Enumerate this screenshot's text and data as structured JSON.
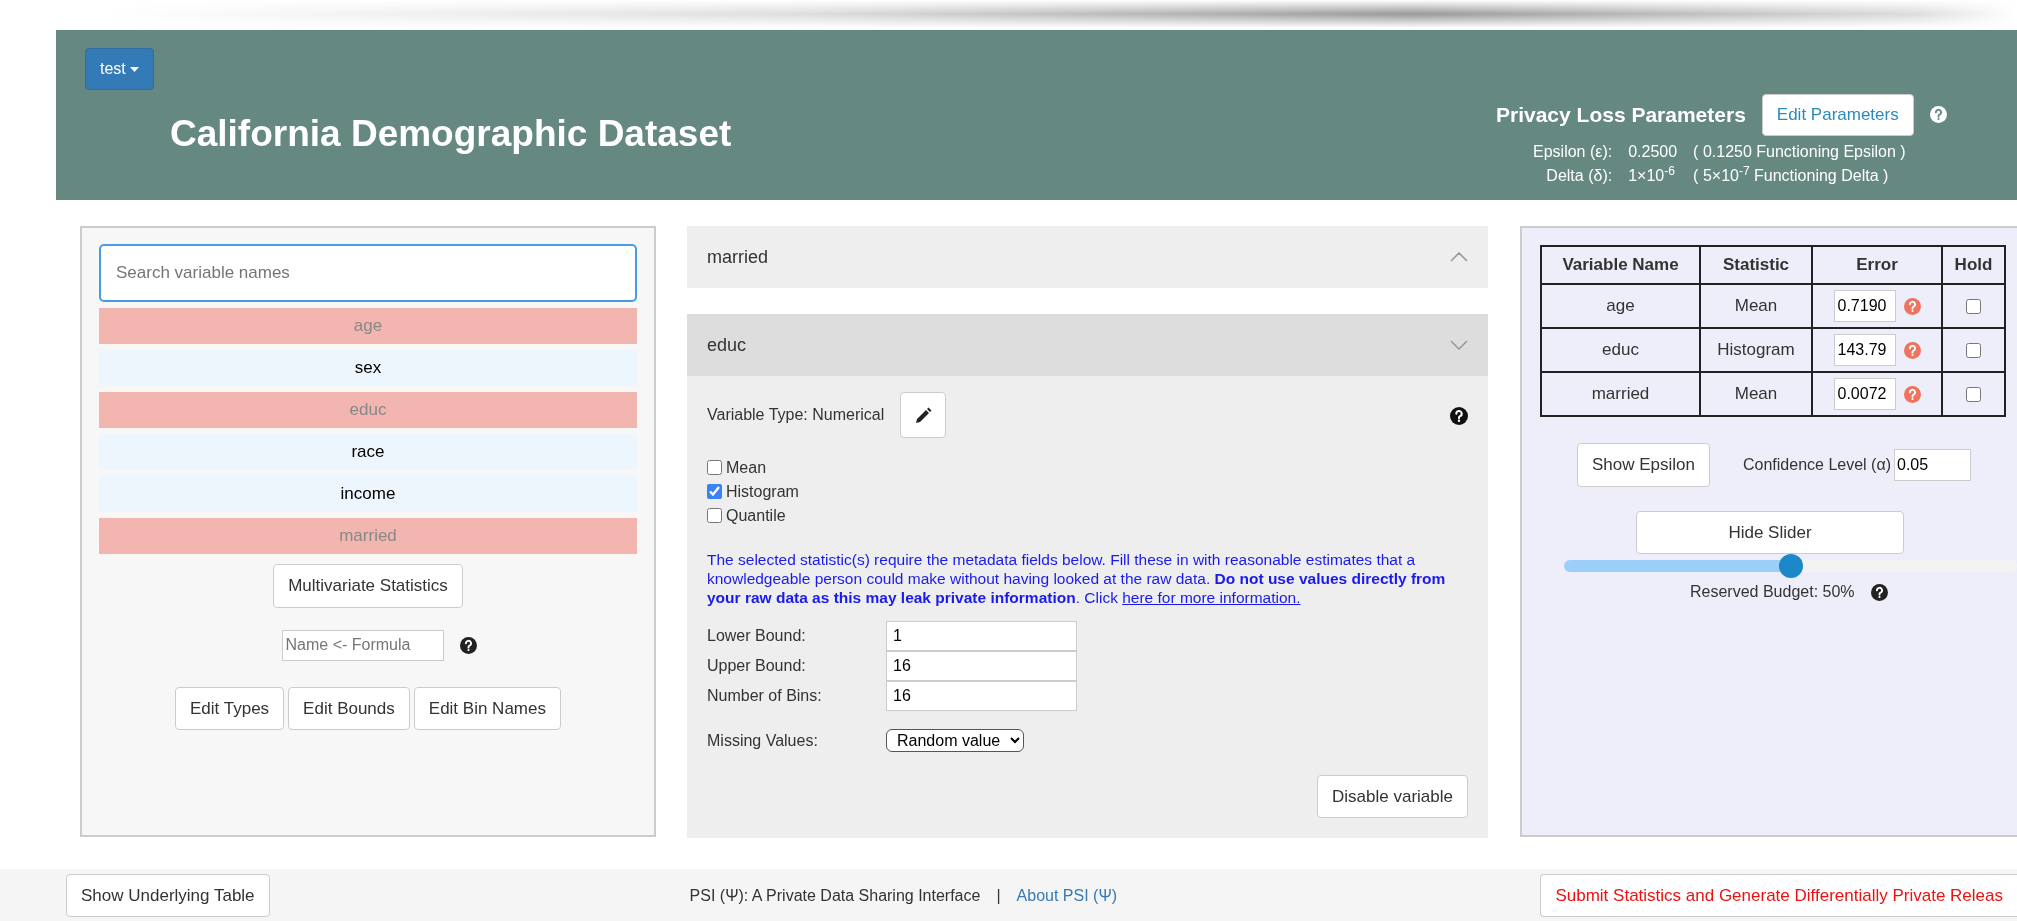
{
  "project_menu": {
    "label": "test"
  },
  "title": "California Demographic Dataset",
  "privacy": {
    "heading": "Privacy Loss Parameters",
    "edit_button": "Edit Parameters",
    "rows": [
      {
        "label": "Epsilon (ε):",
        "value": "0.2500",
        "functioning": "( 0.1250 Functioning Epsilon )"
      },
      {
        "label": "Delta (δ):",
        "value": "1×10$^{-6}$",
        "functioning": "( 5×10$^{-7}$ Functioning Delta )"
      }
    ]
  },
  "variables": {
    "search_placeholder": "Search variable names",
    "items": [
      {
        "name": "age",
        "selected": true
      },
      {
        "name": "sex",
        "selected": false
      },
      {
        "name": "educ",
        "selected": true
      },
      {
        "name": "race",
        "selected": false
      },
      {
        "name": "income",
        "selected": false
      },
      {
        "name": "married",
        "selected": true
      }
    ],
    "multivariate_button": "Multivariate Statistics",
    "formula_placeholder": "Name <- Formula",
    "edit_buttons": [
      "Edit Types",
      "Edit Bounds",
      "Edit Bin Names"
    ]
  },
  "accordion": [
    {
      "title": "married",
      "expanded": false
    },
    {
      "title": "educ",
      "expanded": true,
      "variable_type": "Variable Type: Numerical",
      "statistics": [
        {
          "label": "Mean",
          "checked": false
        },
        {
          "label": "Histogram",
          "checked": true
        },
        {
          "label": "Quantile",
          "checked": false
        }
      ],
      "notice": "The selected statistic(s) require the metadata fields below. Fill these in with reasonable estimates that a knowledgeable person could make without having looked at the raw data. **Do not use values directly from your raw data as this may leak private information**. Click ",
      "notice_link": "here for more information.",
      "fields": [
        {
          "label": "Lower Bound:",
          "value": "1"
        },
        {
          "label": "Upper Bound:",
          "value": "16"
        },
        {
          "label": "Number of Bins:",
          "value": "16"
        }
      ],
      "missing": {
        "label": "Missing Values:",
        "value": "Random value"
      },
      "disable_button": "Disable variable"
    }
  ],
  "budget": {
    "columns": [
      "Variable Name",
      "Statistic",
      "Error",
      "Hold"
    ],
    "rows": [
      {
        "variable": "age",
        "statistic": "Mean",
        "error": "0.7190",
        "hold": false
      },
      {
        "variable": "educ",
        "statistic": "Histogram",
        "error": "143.79",
        "hold": false
      },
      {
        "variable": "married",
        "statistic": "Mean",
        "error": "0.0072",
        "hold": false
      }
    ],
    "show_epsilon": "Show Epsilon",
    "confidence_label": "Confidence Level (α)",
    "confidence_value": "0.05",
    "slider_button": "Hide Slider",
    "slider": {
      "level": 0.5
    },
    "reserved": "Reserved Budget: 50%"
  },
  "footer": {
    "table_button": "Show Underlying Table",
    "credit": "PSI (Ψ): A Private Data Sharing Interface",
    "separator": "|",
    "about_link": "About PSI (Ψ)",
    "submit_button": "Submit Statistics and Generate Differentially Private Releas"
  }
}
